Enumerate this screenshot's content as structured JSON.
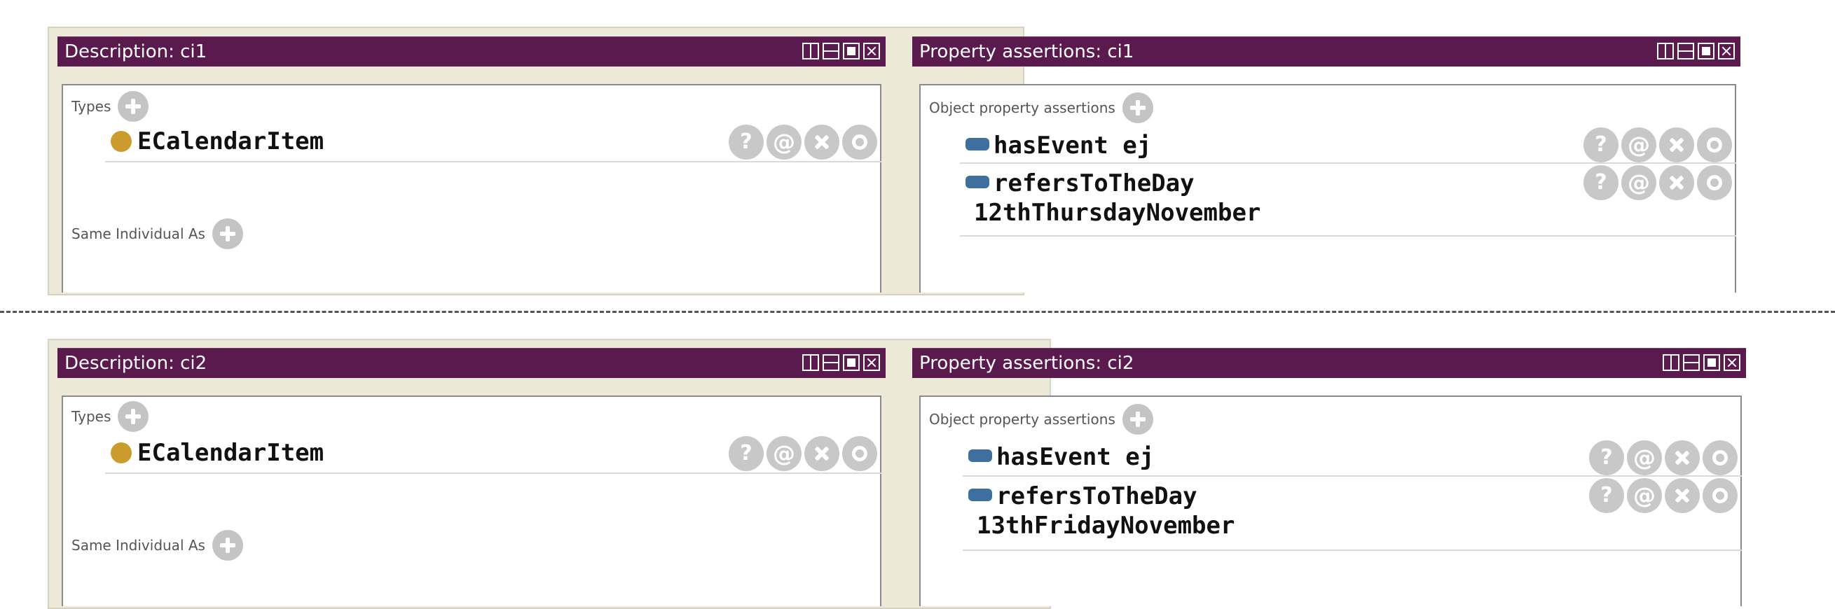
{
  "snapshots": [
    {
      "description": {
        "title": "Description: ci1",
        "types_label": "Types",
        "type_value": "ECalendarItem",
        "same_individual_label": "Same Individual As"
      },
      "property": {
        "title": "Property assertions: ci1",
        "section_label": "Object property assertions",
        "assertions": [
          {
            "property": "hasEvent",
            "value": "ej"
          },
          {
            "property": "refersToTheDay",
            "value": "12thThursdayNovember"
          }
        ]
      }
    },
    {
      "description": {
        "title": "Description: ci2",
        "types_label": "Types",
        "type_value": "ECalendarItem",
        "same_individual_label": "Same Individual As"
      },
      "property": {
        "title": "Property assertions: ci2",
        "section_label": "Object property assertions",
        "assertions": [
          {
            "property": "hasEvent",
            "value": "ej"
          },
          {
            "property": "refersToTheDay",
            "value": "13thFridayNovember"
          }
        ]
      }
    }
  ],
  "icons": {
    "add": "add-circle-icon",
    "explain": "question-icon",
    "annotate": "at-icon",
    "delete": "delete-icon",
    "edit": "edit-circle-icon",
    "class": "class-dot-icon",
    "object_property": "object-property-icon"
  },
  "action_glyphs": {
    "explain": "?",
    "annotate": "@"
  },
  "colors": {
    "titlebar": "#5a1a4e",
    "class_dot": "#cc9b2e",
    "property_bar": "#3e6f9e",
    "action_button": "#c8c8c8",
    "frame": "#ece9d8"
  }
}
